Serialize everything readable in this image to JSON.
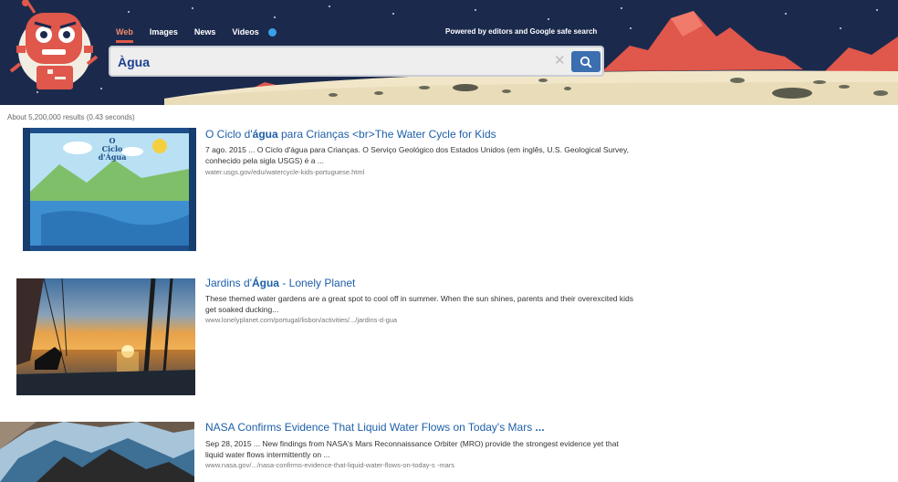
{
  "header": {
    "tabs": [
      {
        "label": "Web",
        "active": true
      },
      {
        "label": "Images",
        "active": false
      },
      {
        "label": "News",
        "active": false
      },
      {
        "label": "Videos",
        "active": false
      }
    ],
    "powered_by": "Powered by editors and Google safe search",
    "search": {
      "value": "Àgua"
    },
    "colors": {
      "sky": "#1b2a4c",
      "moon": "#f1e6c8",
      "mountains": "#e0574c",
      "accent": "#3b6fb0",
      "link": "#1d5fa8"
    }
  },
  "stats": "About 5,200,000 results (0.43 seconds)",
  "results": [
    {
      "title_parts": [
        "O Ciclo d'",
        "água",
        " para Crianças <br>The Water Cycle for Kids"
      ],
      "snippet": "7 ago. 2015 ... O Ciclo d'água para Crianças. O Serviço Geológico dos Estados Unidos (em inglês, U.S. Geological Survey, conhecido pela sigla USGS) é a ...",
      "url": "water.usgs.gov/edu/watercycle-kids-portuguese.html",
      "thumb_text": "O Ciclo d'Água"
    },
    {
      "title_parts": [
        "Jardins d'",
        "Água",
        " - Lonely Planet"
      ],
      "snippet": "These themed water gardens are a great spot to cool off in summer. When the sun shines, parents and their overexcited kids get soaked ducking...",
      "url": "www.lonelyplanet.com/portugal/lisbon/activities/.../jardins-d-gua"
    },
    {
      "title_parts": [
        "NASA Confirms Evidence That Liquid Water Flows on Today's Mars",
        " ...",
        ""
      ],
      "snippet": "Sep 28, 2015 ... New findings from NASA's Mars Reconnaissance Orbiter (MRO) provide the strongest evidence yet that liquid water flows intermittently on ...",
      "url": "www.nasa.gov/.../nasa-confirms-evidence-that-liquid-water-flows-on-today-s -mars"
    }
  ]
}
